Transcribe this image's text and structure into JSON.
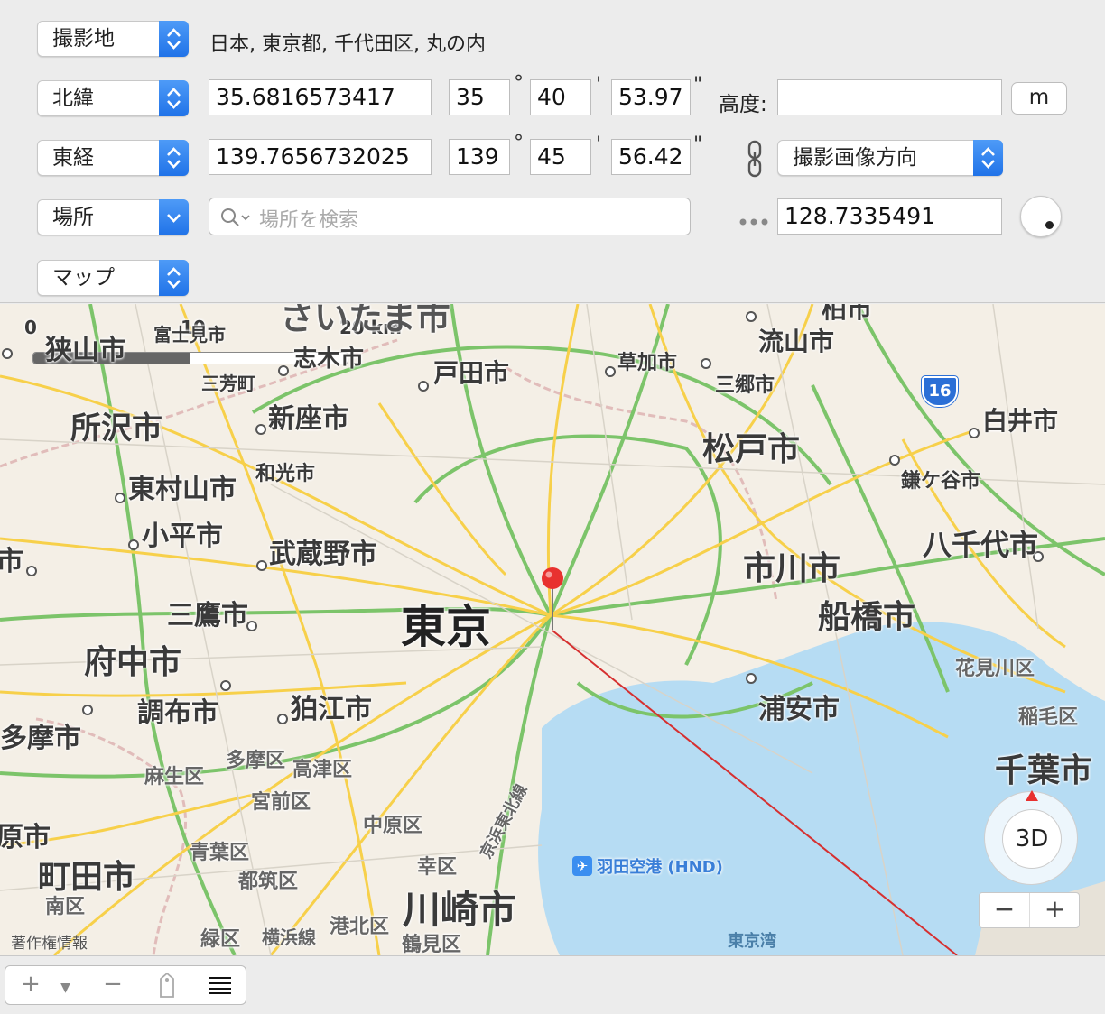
{
  "location_source": {
    "label": "撮影地",
    "value": "日本, 東京都, 千代田区, 丸の内"
  },
  "latitude": {
    "ref_label": "北緯",
    "decimal": "35.6816573417",
    "deg": "35",
    "min": "40",
    "sec": "53.97",
    "deg_symbol": "°",
    "min_symbol": "'",
    "sec_symbol": "\""
  },
  "altitude": {
    "label": "高度:",
    "value": "",
    "unit_button": "m"
  },
  "longitude": {
    "ref_label": "東経",
    "decimal": "139.7656732025",
    "deg": "139",
    "min": "45",
    "sec": "56.42"
  },
  "direction": {
    "ref_label": "撮影画像方向",
    "value": "128.7335491"
  },
  "place": {
    "label": "場所",
    "search_placeholder": "場所を検索"
  },
  "map_type": {
    "label": "マップ"
  },
  "map": {
    "scale": {
      "zero": "0",
      "mid": "10",
      "end": "20 km"
    },
    "compass_3d": "3D",
    "zoom_out": "−",
    "zoom_in": "+",
    "route_shield": "16",
    "airport": "羽田空港 (HND)",
    "copyright": "著作権情報",
    "labels": {
      "tokyo": "東京",
      "saitama": "さいたま市",
      "sayama": "狭山市",
      "fujimi": "富士見市",
      "shiki": "志木市",
      "miyoshi": "三芳町",
      "toda": "戸田市",
      "soka": "草加市",
      "misato": "三郷市",
      "nagareyama": "流山市",
      "kashiwa": "柏市",
      "tokorozawa": "所沢市",
      "niiza": "新座市",
      "wako": "和光市",
      "matsudo": "松戸市",
      "shiroi": "白井市",
      "kamagaya": "鎌ケ谷市",
      "higashimurayama": "東村山市",
      "kodaira": "小平市",
      "musashino": "武蔵野市",
      "yachiyo": "八千代市",
      "ichikawa": "市川市",
      "funabashi": "船橋市",
      "mitaka": "三鷹市",
      "fuchu": "府中市",
      "chofu": "調布市",
      "komae": "狛江市",
      "urayasu": "浦安市",
      "hanamigawa": "花見川区",
      "inage": "稲毛区",
      "tama": "多摩市",
      "tamaku": "多摩区",
      "takatsu": "高津区",
      "asao": "麻生区",
      "chiba": "千葉市",
      "miyamae": "宮前区",
      "nakahara": "中原区",
      "aoba": "青葉区",
      "tsuzuki": "都筑区",
      "saiwai": "幸区",
      "machida": "町田市",
      "minami": "南区",
      "kawasaki": "川崎市",
      "midori": "緑区",
      "kohoku": "港北区",
      "tsurumi": "鶴見区",
      "yokohama_line": "横浜線",
      "keihin": "京浜東北線",
      "tokyo_bay": "東京湾",
      "shi_left": "市",
      "shi_left2": "原市"
    }
  },
  "bottom": {
    "add": "+",
    "remove": "−",
    "list_icon": "list-icon"
  },
  "colors": {
    "accent": "#2a7ff0",
    "water": "#b6dcf3",
    "pin": "#e8312f",
    "major_road": "#f7d04a",
    "expressway": "#7cc46a"
  }
}
